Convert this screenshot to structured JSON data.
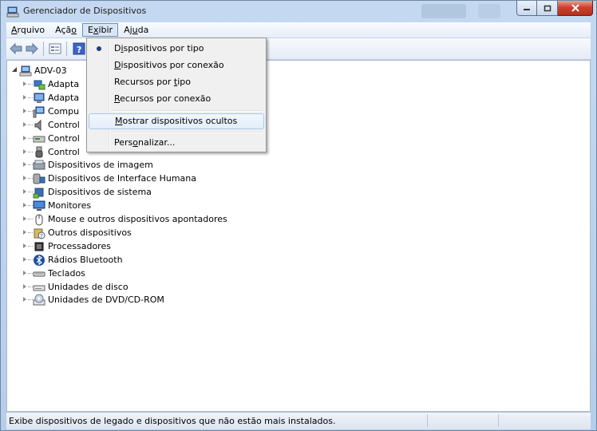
{
  "window": {
    "title": "Gerenciador de Dispositivos",
    "colors": {
      "titlebar": "#c4d9f1",
      "close": "#c8442f",
      "selection": "#dae6f5"
    }
  },
  "menubar": {
    "items": [
      {
        "pre": "",
        "acc": "A",
        "post": "rquivo"
      },
      {
        "pre": "Açã",
        "acc": "o",
        "post": ""
      },
      {
        "pre": "E",
        "acc": "x",
        "post": "ibir"
      },
      {
        "pre": "Aj",
        "acc": "u",
        "post": "da"
      }
    ]
  },
  "toolbar": {
    "icons": [
      "back-arrow-icon",
      "forward-arrow-icon",
      "properties-icon",
      "help-icon"
    ]
  },
  "view_menu": {
    "items": [
      {
        "pre": "D",
        "acc": "i",
        "post": "spositivos por tipo",
        "checked": true
      },
      {
        "pre": "",
        "acc": "D",
        "post": "ispositivos por conexão",
        "checked": false
      },
      {
        "pre": "Recursos por ",
        "acc": "t",
        "post": "ipo",
        "checked": false
      },
      {
        "pre": "",
        "acc": "R",
        "post": "ecursos por conexão",
        "checked": false
      },
      {
        "pre": "",
        "acc": "M",
        "post": "ostrar dispositivos ocultos",
        "checked": false
      },
      {
        "pre": "Pers",
        "acc": "o",
        "post": "nalizar...",
        "checked": false
      }
    ]
  },
  "tree": {
    "root": "ADV-03",
    "nodes": [
      {
        "label": "Adapta",
        "icon": "network-adapter-icon"
      },
      {
        "label": "Adapta",
        "icon": "display-adapter-icon"
      },
      {
        "label": "Compu",
        "icon": "computer-icon"
      },
      {
        "label": "Control",
        "icon": "sound-controller-icon"
      },
      {
        "label": "Control",
        "icon": "storage-controller-icon"
      },
      {
        "label": "Control",
        "icon": "usb-controller-icon"
      },
      {
        "label": "Dispositivos de imagem",
        "icon": "imaging-device-icon"
      },
      {
        "label": "Dispositivos de Interface Humana",
        "icon": "hid-device-icon"
      },
      {
        "label": "Dispositivos de sistema",
        "icon": "system-device-icon"
      },
      {
        "label": "Monitores",
        "icon": "monitor-icon"
      },
      {
        "label": "Mouse e outros dispositivos apontadores",
        "icon": "mouse-icon"
      },
      {
        "label": "Outros dispositivos",
        "icon": "unknown-device-icon"
      },
      {
        "label": "Processadores",
        "icon": "processor-icon"
      },
      {
        "label": "Rádios Bluetooth",
        "icon": "bluetooth-icon"
      },
      {
        "label": "Teclados",
        "icon": "keyboard-icon"
      },
      {
        "label": "Unidades de disco",
        "icon": "disk-drive-icon"
      },
      {
        "label": "Unidades de DVD/CD-ROM",
        "icon": "dvd-drive-icon"
      }
    ]
  },
  "statusbar": {
    "text": "Exibe dispositivos de legado e dispositivos que não estão mais instalados."
  }
}
